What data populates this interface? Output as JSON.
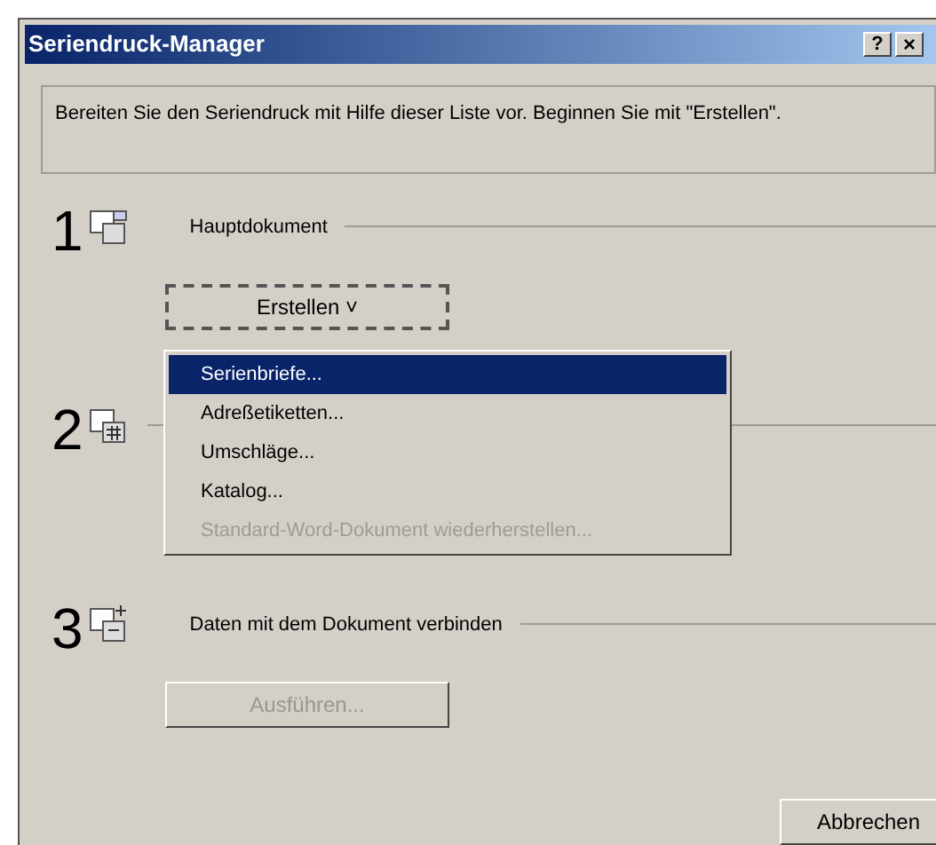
{
  "window": {
    "title": "Seriendruck-Manager",
    "help": "?",
    "close": "×"
  },
  "intro": "Bereiten Sie den Seriendruck mit Hilfe dieser Liste vor. Beginnen Sie mit \"Erstellen\".",
  "steps": [
    {
      "number": "1",
      "label": "Hauptdokument",
      "button": {
        "label": "Erstellen ˅",
        "disabled": false,
        "focused": true
      }
    },
    {
      "number": "2"
    },
    {
      "number": "3",
      "label": "Daten mit dem Dokument verbinden",
      "button": {
        "label": "Ausführen...",
        "disabled": true,
        "focused": false
      }
    }
  ],
  "menu": [
    {
      "label": "Serienbriefe...",
      "selected": true,
      "disabled": false
    },
    {
      "label": "Adreßetiketten...",
      "selected": false,
      "disabled": false
    },
    {
      "label": "Umschläge...",
      "selected": false,
      "disabled": false
    },
    {
      "label": "Katalog...",
      "selected": false,
      "disabled": false
    },
    {
      "label": "Standard-Word-Dokument wiederherstellen...",
      "selected": false,
      "disabled": true
    }
  ],
  "cancel_button": "Abbrechen"
}
